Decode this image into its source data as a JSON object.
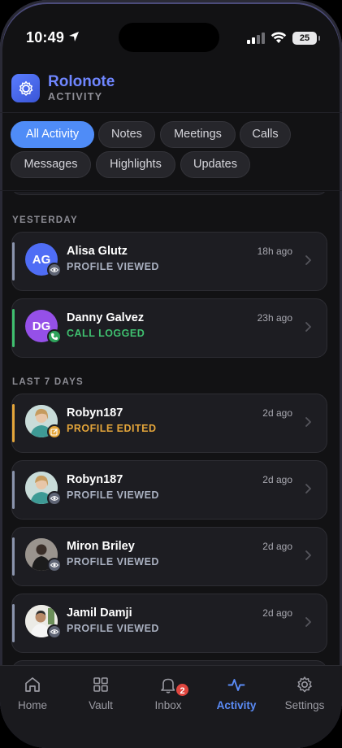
{
  "status_bar": {
    "time": "10:49",
    "battery": "25"
  },
  "app": {
    "title": "Rolonote",
    "subtitle": "ACTIVITY"
  },
  "filters": [
    {
      "label": "All Activity",
      "active": true
    },
    {
      "label": "Notes",
      "active": false
    },
    {
      "label": "Meetings",
      "active": false
    },
    {
      "label": "Calls",
      "active": false
    },
    {
      "label": "Messages",
      "active": false
    },
    {
      "label": "Highlights",
      "active": false
    },
    {
      "label": "Updates",
      "active": false
    }
  ],
  "sections": [
    {
      "label": "YESTERDAY",
      "items": [
        {
          "name": "Alisa Glutz",
          "initials": "AG",
          "action": "PROFILE VIEWED",
          "ago": "18h ago",
          "type": "view",
          "avatar_color": "#4f6df5"
        },
        {
          "name": "Danny Galvez",
          "initials": "DG",
          "action": "CALL LOGGED",
          "ago": "23h ago",
          "type": "call",
          "avatar_color": "#9550e8"
        }
      ]
    },
    {
      "label": "LAST 7 DAYS",
      "items": [
        {
          "name": "Robyn187",
          "action": "PROFILE EDITED",
          "ago": "2d ago",
          "type": "edit",
          "photo": "robyn"
        },
        {
          "name": "Robyn187",
          "action": "PROFILE VIEWED",
          "ago": "2d ago",
          "type": "view",
          "photo": "robyn"
        },
        {
          "name": "Miron Briley",
          "action": "PROFILE VIEWED",
          "ago": "2d ago",
          "type": "view",
          "photo": "miron"
        },
        {
          "name": "Jamil Damji",
          "action": "PROFILE VIEWED",
          "ago": "2d ago",
          "type": "view",
          "photo": "jamil"
        }
      ]
    }
  ],
  "type_colors": {
    "view": "#8a94ad",
    "call": "#3fbf6f",
    "edit": "#e4a53a"
  },
  "tabs": [
    {
      "label": "Home",
      "icon": "home-icon",
      "active": false
    },
    {
      "label": "Vault",
      "icon": "grid-icon",
      "active": false
    },
    {
      "label": "Inbox",
      "icon": "bell-icon",
      "active": false,
      "badge": "2"
    },
    {
      "label": "Activity",
      "icon": "activity-icon",
      "active": true
    },
    {
      "label": "Settings",
      "icon": "gear-icon",
      "active": false
    }
  ]
}
